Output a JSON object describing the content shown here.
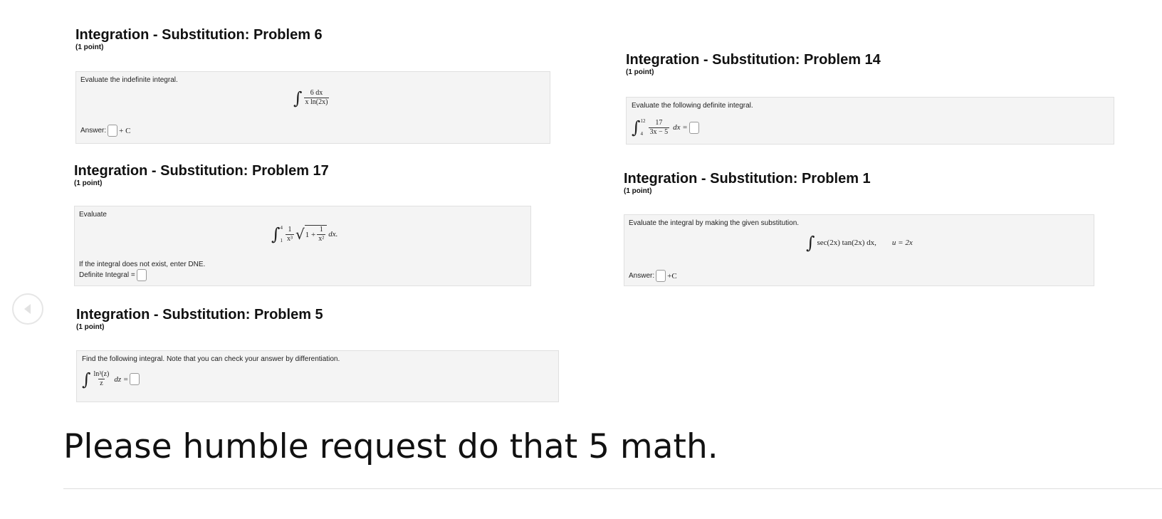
{
  "problems": [
    {
      "title": "Integration - Substitution: Problem 6",
      "points": "(1 point)",
      "instruction": "Evaluate the indefinite integral.",
      "integral": {
        "numerator": "6 dx",
        "denominator": "x ln(2x)"
      },
      "answer_label": "Answer:",
      "suffix": "+ C"
    },
    {
      "title": "Integration - Substitution: Problem 14",
      "points": "(1 point)",
      "instruction": "Evaluate the following definite integral.",
      "integral": {
        "upper": "12",
        "lower": "4",
        "numerator": "17",
        "denominator": "3x − 5",
        "tail": "dx ="
      }
    },
    {
      "title": "Integration - Substitution: Problem 17",
      "points": "(1 point)",
      "instruction": "Evaluate",
      "integral": {
        "upper": "4",
        "lower": "1",
        "numerator": "1",
        "denominator": "x³",
        "inner_start": "1 +",
        "inner_num": "1",
        "inner_den": "x²",
        "tail": "dx."
      },
      "note": "If the integral does not exist, enter DNE.",
      "answer_label": "Definite Integral ="
    },
    {
      "title": "Integration - Substitution: Problem 1",
      "points": "(1 point)",
      "instruction": "Evaluate the integral by making the given substitution.",
      "integral": {
        "body": "sec(2x) tan(2x) dx,",
        "substitution": "u = 2x"
      },
      "answer_label": "Answer:",
      "suffix": "+C"
    },
    {
      "title": "Integration - Substitution: Problem 5",
      "points": "(1 point)",
      "instruction": "Find the following integral. Note that you can check your answer by differentiation.",
      "integral": {
        "numerator": "ln³(z)",
        "denominator": "z",
        "tail": "dz ="
      }
    }
  ],
  "caption": "Please humble request do that 5 math."
}
